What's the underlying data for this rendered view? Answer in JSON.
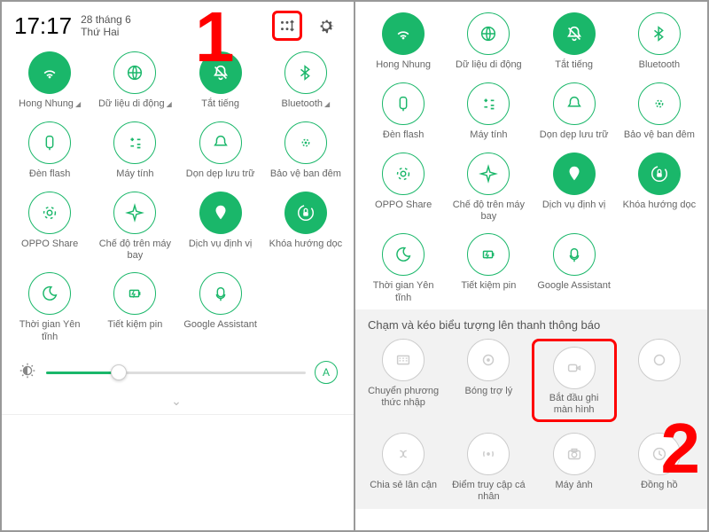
{
  "accent": "#1ab76a",
  "highlight": "#ff0000",
  "left": {
    "time": "17:17",
    "date_line1": "28 tháng 6",
    "date_line2": "Thứ Hai",
    "annotation": "1",
    "auto_brightness": "A",
    "tiles": [
      {
        "id": "wifi",
        "label": "Hong Nhung",
        "state": "on",
        "expand": true
      },
      {
        "id": "data",
        "label": "Dữ liệu di động",
        "state": "off",
        "expand": true
      },
      {
        "id": "mute",
        "label": "Tắt tiếng",
        "state": "on",
        "expand": false
      },
      {
        "id": "bt",
        "label": "Bluetooth",
        "state": "off",
        "expand": true
      },
      {
        "id": "flash",
        "label": "Đèn flash",
        "state": "off"
      },
      {
        "id": "calc",
        "label": "Máy tính",
        "state": "off"
      },
      {
        "id": "clean",
        "label": "Dọn dẹp lưu trữ",
        "state": "off"
      },
      {
        "id": "night",
        "label": "Bảo vệ ban đêm",
        "state": "off"
      },
      {
        "id": "share",
        "label": "OPPO Share",
        "state": "off"
      },
      {
        "id": "airplane",
        "label": "Chế độ trên máy bay",
        "state": "off"
      },
      {
        "id": "location",
        "label": "Dịch vụ định vị",
        "state": "on"
      },
      {
        "id": "rotlock",
        "label": "Khóa hướng dọc",
        "state": "on"
      },
      {
        "id": "dnd",
        "label": "Thời gian Yên tĩnh",
        "state": "off"
      },
      {
        "id": "battery",
        "label": "Tiết kiệm pin",
        "state": "off"
      },
      {
        "id": "assistant",
        "label": "Google Assistant",
        "state": "off"
      }
    ]
  },
  "right": {
    "annotation": "2",
    "instruction": "Chạm và kéo biểu tượng lên thanh thông báo",
    "tiles_active": [
      {
        "id": "wifi",
        "label": "Hong Nhung",
        "state": "on"
      },
      {
        "id": "data",
        "label": "Dữ liệu di động",
        "state": "off"
      },
      {
        "id": "mute",
        "label": "Tắt tiếng",
        "state": "on"
      },
      {
        "id": "bt",
        "label": "Bluetooth",
        "state": "off"
      },
      {
        "id": "flash",
        "label": "Đèn flash",
        "state": "off"
      },
      {
        "id": "calc",
        "label": "Máy tính",
        "state": "off"
      },
      {
        "id": "clean",
        "label": "Dọn dẹp lưu trữ",
        "state": "off"
      },
      {
        "id": "night",
        "label": "Bảo vệ ban đêm",
        "state": "off"
      },
      {
        "id": "share",
        "label": "OPPO Share",
        "state": "off"
      },
      {
        "id": "airplane",
        "label": "Chế độ trên máy bay",
        "state": "off"
      },
      {
        "id": "location",
        "label": "Dịch vụ định vị",
        "state": "on"
      },
      {
        "id": "rotlock",
        "label": "Khóa hướng dọc",
        "state": "on"
      },
      {
        "id": "dnd",
        "label": "Thời gian Yên tĩnh",
        "state": "off"
      },
      {
        "id": "battery",
        "label": "Tiết kiệm pin",
        "state": "off"
      },
      {
        "id": "assistant",
        "label": "Google Assistant",
        "state": "off"
      }
    ],
    "tiles_inactive": [
      {
        "id": "input",
        "label": "Chuyển phương thức nhập"
      },
      {
        "id": "orb",
        "label": "Bóng trợ lý"
      },
      {
        "id": "record",
        "label": "Bắt đầu ghi màn hình",
        "highlight": true
      },
      {
        "id": "hidden1",
        "label": ""
      },
      {
        "id": "nearby",
        "label": "Chia sẻ lân cận"
      },
      {
        "id": "hotspot",
        "label": "Điểm truy cập cá nhân"
      },
      {
        "id": "camera",
        "label": "Máy ảnh"
      },
      {
        "id": "clock",
        "label": "Đồng hồ"
      }
    ]
  }
}
